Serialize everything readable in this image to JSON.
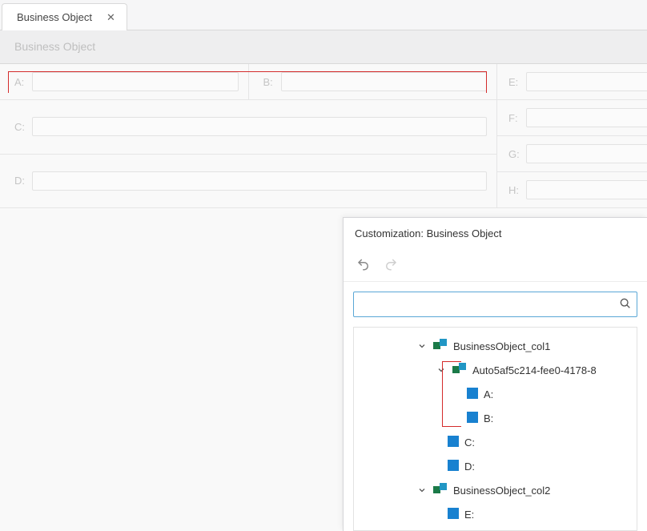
{
  "tab": {
    "title": "Business Object"
  },
  "header": {
    "title": "Business Object"
  },
  "fields": {
    "A": {
      "label": "A:"
    },
    "B": {
      "label": "B:"
    },
    "C": {
      "label": "C:"
    },
    "D": {
      "label": "D:"
    },
    "E": {
      "label": "E:"
    },
    "F": {
      "label": "F:"
    },
    "G": {
      "label": "G:"
    },
    "H": {
      "label": "H:"
    }
  },
  "popup": {
    "title": "Customization: Business Object",
    "search_value": ""
  },
  "tree": {
    "col1": {
      "label": "BusinessObject_col1"
    },
    "col1_group": {
      "label": "Auto5af5c214-fee0-4178-8"
    },
    "item_A": {
      "label": "A:"
    },
    "item_B": {
      "label": "B:"
    },
    "item_C": {
      "label": "C:"
    },
    "item_D": {
      "label": "D:"
    },
    "col2": {
      "label": "BusinessObject_col2"
    },
    "item_E": {
      "label": "E:"
    }
  }
}
